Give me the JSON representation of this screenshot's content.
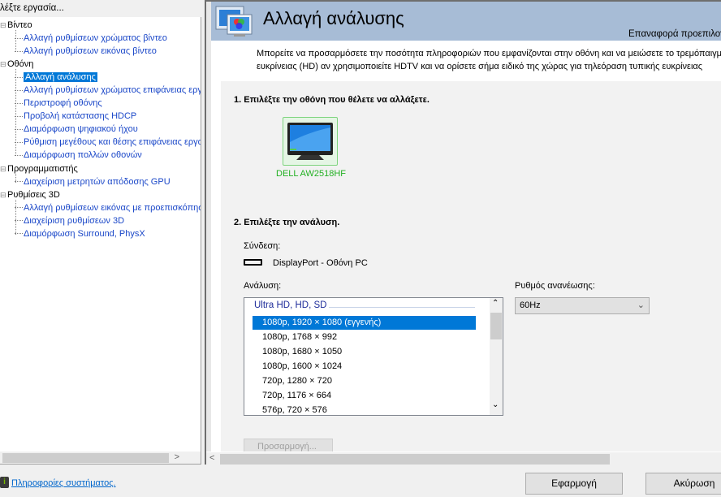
{
  "left_panel": {
    "header": "λέξτε εργασία...",
    "tree": [
      {
        "label": "Βίντεο",
        "children": [
          "Αλλαγή ρυθμίσεων χρώματος βίντεο",
          "Αλλαγή ρυθμίσεων εικόνας βίντεο"
        ]
      },
      {
        "label": "Οθόνη",
        "children": [
          "Αλλαγή ανάλυσης",
          "Αλλαγή ρυθμίσεων χρώματος επιφάνειας εργασίας",
          "Περιστροφή οθόνης",
          "Προβολή κατάστασης HDCP",
          "Διαμόρφωση ψηφιακού ήχου",
          "Ρύθμιση μεγέθους και θέσης επιφάνειας εργασίας",
          "Διαμόρφωση πολλών οθονών"
        ]
      },
      {
        "label": "Προγραμματιστής",
        "children": [
          "Διαχείριση μετρητών απόδοσης GPU"
        ]
      },
      {
        "label": "Ρυθμίσεις 3D",
        "children": [
          "Αλλαγή ρυθμίσεων εικόνας με προεπισκόπηση",
          "Διαχείριση ρυθμίσεων 3D",
          "Διαμόρφωση Surround, PhysX"
        ]
      }
    ],
    "selected": "Αλλαγή ανάλυσης"
  },
  "header": {
    "title": "Αλλαγή ανάλυσης",
    "reset": "Επαναφορά προεπιλογών"
  },
  "description": [
    "Μπορείτε να προσαρμόσετε την ποσότητα πληροφοριών που εμφανίζονται στην οθόνη και να μειώσετε το τρεμόπαιγμα",
    "ευκρίνειας (HD) αν χρησιμοποιείτε HDTV και να ορίσετε σήμα ειδικό της χώρας για τηλεόραση τυπικής ευκρίνειας"
  ],
  "step1": {
    "title": "1. Επιλέξτε την οθόνη που θέλετε να αλλάξετε.",
    "monitor": "DELL AW2518HF"
  },
  "step2": {
    "title": "2. Επιλέξτε την ανάλυση.",
    "connection_label": "Σύνδεση:",
    "connection": "DisplayPort - Οθόνη PC",
    "resolution_label": "Ανάλυση:",
    "group": "Ultra HD, HD, SD",
    "resolutions": [
      "1080p, 1920 × 1080 (εγγενής)",
      "1080p, 1768 × 992",
      "1080p, 1680 × 1050",
      "1080p, 1600 × 1024",
      "720p, 1280 × 720",
      "720p, 1176 × 664",
      "576p, 720 × 576"
    ],
    "selected_index": 0,
    "refresh_label": "Ρυθμός ανανέωσης:",
    "refresh_value": "60Hz",
    "customize": "Προσαρμογή..."
  },
  "footer": {
    "system_info": "Πληροφορίες συστήματος.",
    "apply": "Εφαρμογή",
    "cancel": "Ακύρωση"
  }
}
